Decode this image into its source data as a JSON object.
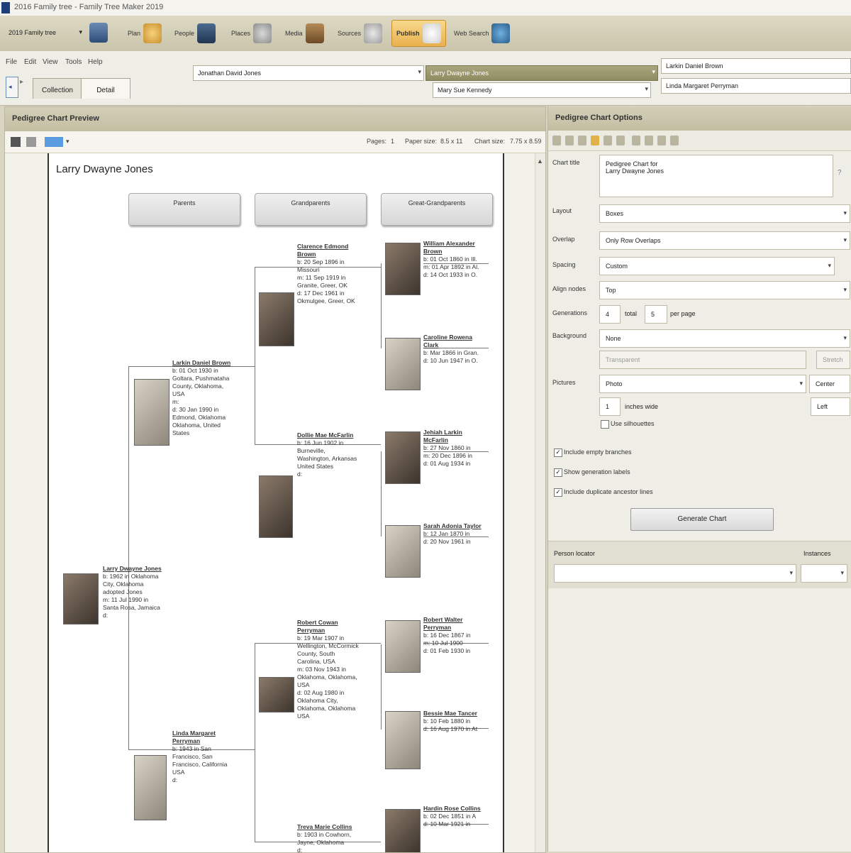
{
  "window": {
    "title": "2016 Family tree - Family Tree Maker 2019"
  },
  "toolbar": {
    "tree_name": "2019 Family tree",
    "items": [
      {
        "label": "Plan",
        "icon": "plan-icon"
      },
      {
        "label": "People",
        "icon": "people-icon"
      },
      {
        "label": "Places",
        "icon": "places-icon"
      },
      {
        "label": "Media",
        "icon": "media-icon"
      },
      {
        "label": "Sources",
        "icon": "sources-icon"
      },
      {
        "label": "Publish",
        "icon": "publish-icon"
      },
      {
        "label": "Web Search",
        "icon": "web-search-icon"
      }
    ]
  },
  "menu": {
    "items": [
      "File",
      "Edit",
      "View",
      "Tools",
      "Help"
    ]
  },
  "nav": {
    "tabs": [
      "Collection",
      "Detail"
    ],
    "father": "Jonathan David Jones",
    "mother": "Mary Sue Kennedy",
    "selected_person": "Larry Dwayne Jones",
    "spouse1": "Larkin Daniel Brown",
    "spouse2": "Linda Margaret Perryman"
  },
  "preview": {
    "header": "Pedigree Chart Preview",
    "pages_label": "Pages:",
    "pages": "1",
    "paper_size_label": "Paper size:",
    "paper_size": "8.5 x 11",
    "chart_size_label": "Chart size:",
    "chart_size": "7.75 x 8.59",
    "chart_title": "Larry Dwayne Jones",
    "generations": [
      "Parents",
      "Grandparents",
      "Great-Grandparents"
    ],
    "root": {
      "name": "Larry Dwayne Jones",
      "facts": "b: 1962 in Oklahoma\nCity, Oklahoma\nadopted Jones\nm: 11 Jul 1990 in\nSanta Rosa, Jamaica\nd:"
    },
    "father": {
      "name": "Larkin Daniel Brown",
      "facts": "b: 01 Oct 1930 in\nGoltara, Pushmataha\nCounty, Oklahoma,\nUSA\nm:\nd: 30 Jan 1990 in\nEdmond, Oklahoma\nOklahoma, United\nStates"
    },
    "mother": {
      "name": "Linda Margaret\nPerryman",
      "facts": "b: 1943 in San\nFrancisco, San\nFrancisco, California\nUSA\nd:"
    },
    "pgf": {
      "name": "Clarence Edmond\nBrown",
      "facts": "b: 20 Sep 1896 in\nMissouri\nm: 11 Sep 1919 in\nGranite, Greer, OK\nd: 17 Dec 1961 in\nOkmulgee, Greer, OK"
    },
    "pgm": {
      "name": "Dollie Mae McFarlin",
      "facts": "b: 16 Jun 1902 in\nBurneville,\nWashington, Arkansas\nUnited States\nd:"
    },
    "mgf": {
      "name": "Robert Cowan\nPerryman",
      "facts": "b: 19 Mar 1907 in\nWellington, McCormick\nCounty, South\nCarolina, USA\nm: 03 Nov 1943 in\nOklahoma, Oklahoma,\nUSA\nd: 02 Aug 1980 in\nOklahoma City,\nOklahoma, Oklahoma\nUSA"
    },
    "mgm": {
      "name": "Treva Marie Collins",
      "facts": "b: 1903 in Cowhorn,\nJayne, Oklahoma\nd:"
    },
    "ggp": [
      {
        "name": "William Alexander\nBrown",
        "facts": "b: 01 Oct 1860 in Ill.\nm: 01 Apr 1892 in Al.\nd: 14 Oct 1933 in O."
      },
      {
        "name": "Caroline Rowena\nClark",
        "facts": "b: Mar 1866 in Gran.\nd: 10 Jun 1947 in O."
      },
      {
        "name": "Jehiah Larkin\nMcFarlin",
        "facts": "b: 27 Nov 1860 in\nm: 20 Dec 1896 in\nd: 01 Aug 1934 in"
      },
      {
        "name": "Sarah Adonia Taylor",
        "facts": "b: 12 Jan 1870 in\nd: 20 Nov 1961 in"
      },
      {
        "name": "Robert Walter\nPerryman",
        "facts": "b: 16 Dec 1867 in\nm: 10 Jul 1900\nd: 01 Feb 1930 in"
      },
      {
        "name": "Bessie Mae Tancer",
        "facts": "b: 10 Feb 1880 in\nd: 16 Aug 1970 in At"
      },
      {
        "name": "Hardin Rose Collins",
        "facts": "b: 02 Dec 1851 in A\nd: 10 Mar 1921 in"
      }
    ]
  },
  "options": {
    "header": "Pedigree Chart Options",
    "chart_title_label": "Chart title",
    "chart_title_value": "Pedigree Chart for\nLarry Dwayne Jones",
    "layout_label": "Layout",
    "layout_value": "Boxes",
    "overlap_label": "Overlap",
    "overlap_value": "Only Row Overlaps",
    "spacing_label": "Spacing",
    "spacing_value": "Custom",
    "align_label": "Align nodes",
    "align_value": "Top",
    "generations_label": "Generations",
    "generations_total": "4",
    "generations_total_label": "total",
    "generations_per_page": "5",
    "generations_per_page_label": "per page",
    "background_label": "Background",
    "background_value": "None",
    "bg_transparency": "Transparent",
    "bg_position": "Stretch",
    "pictures_label": "Pictures",
    "pictures_value": "Photo",
    "pictures_align": "Center",
    "pictures_size": "1",
    "pictures_units": "inches wide",
    "pictures_side": "Left",
    "use_silhouettes": "Use silhouettes",
    "include_empty": "Include empty branches",
    "show_gen_labels": "Show generation labels",
    "include_duplicate": "Include duplicate ancestor lines",
    "generate": "Generate Chart",
    "person_locator_label": "Person locator",
    "instances_label": "Instances"
  }
}
